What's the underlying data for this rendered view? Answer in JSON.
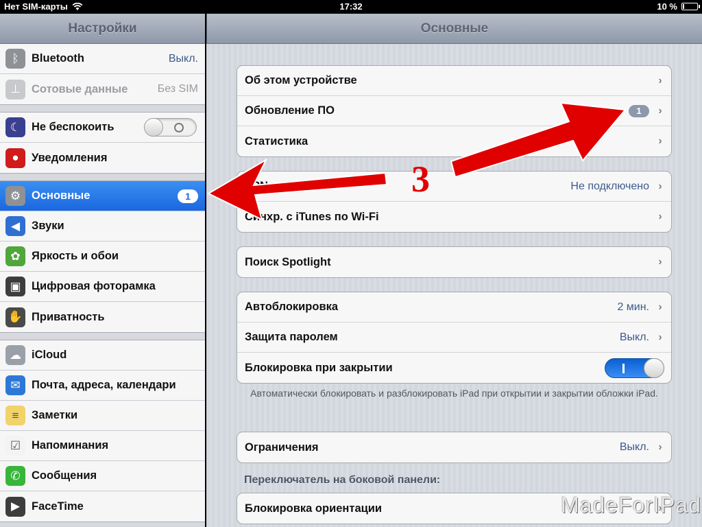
{
  "statusbar": {
    "carrier": "Нет SIM-карты",
    "time": "17:32",
    "battery": "10 %",
    "battery_level": 0.1
  },
  "sidebar": {
    "title": "Настройки",
    "groups": [
      [
        {
          "label": "Bluetooth",
          "value": "Выкл.",
          "icon": "bluetooth-icon",
          "color": "#8e9196"
        },
        {
          "label": "Сотовые данные",
          "value": "Без SIM",
          "icon": "antenna-icon",
          "color": "#c7c9cc",
          "disabled": true
        }
      ],
      [
        {
          "label": "Не беспокоить",
          "icon": "moon-icon",
          "color": "#3a3f8f",
          "toggle": false
        },
        {
          "label": "Уведомления",
          "icon": "notifications-icon",
          "color": "#d01b1b"
        }
      ],
      [
        {
          "label": "Основные",
          "icon": "gear-icon",
          "color": "#8e9196",
          "badge": "1",
          "active": true
        },
        {
          "label": "Звуки",
          "icon": "speaker-icon",
          "color": "#2f6fd1"
        },
        {
          "label": "Яркость и обои",
          "icon": "flower-icon",
          "color": "#4fa63b"
        },
        {
          "label": "Цифровая фоторамка",
          "icon": "photo-frame-icon",
          "color": "#3d3d3d"
        },
        {
          "label": "Приватность",
          "icon": "hand-icon",
          "color": "#4a4a4a"
        }
      ],
      [
        {
          "label": "iCloud",
          "icon": "cloud-icon",
          "color": "#9aa0a8"
        },
        {
          "label": "Почта, адреса, календари",
          "icon": "mail-icon",
          "color": "#2d78d6"
        },
        {
          "label": "Заметки",
          "icon": "notes-icon",
          "color": "#f0d36a"
        },
        {
          "label": "Напоминания",
          "icon": "reminders-icon",
          "color": "#f3f3f3"
        },
        {
          "label": "Сообщения",
          "icon": "messages-icon",
          "color": "#38b53a"
        },
        {
          "label": "FaceTime",
          "icon": "facetime-icon",
          "color": "#3d3d3d"
        }
      ]
    ]
  },
  "main": {
    "title": "Основные",
    "group1": [
      {
        "label": "Об этом устройстве"
      },
      {
        "label": "Обновление ПО",
        "badge": "1"
      },
      {
        "label": "Статистика"
      }
    ],
    "group2": [
      {
        "label": "VPN",
        "value": "Не подключено"
      },
      {
        "label": "Синхр. с iTunes по Wi-Fi"
      }
    ],
    "group3": [
      {
        "label": "Поиск Spotlight"
      }
    ],
    "group4": [
      {
        "label": "Автоблокировка",
        "value": "2 мин."
      },
      {
        "label": "Защита паролем",
        "value": "Выкл."
      },
      {
        "label": "Блокировка при закрытии",
        "toggle": true
      }
    ],
    "footnote": "Автоматически блокировать и разблокировать iPad при открытии и закрытии обложки iPad.",
    "group5": [
      {
        "label": "Ограничения",
        "value": "Выкл."
      }
    ],
    "section_header": "Переключатель на боковой панели:",
    "group6": [
      {
        "label": "Блокировка ориентации"
      }
    ]
  },
  "annotation": {
    "number": "3",
    "color": "#e00000"
  },
  "watermark": "MadeForIPad.ru"
}
